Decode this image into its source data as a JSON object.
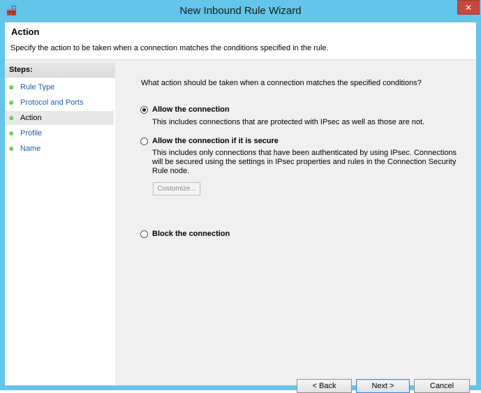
{
  "window": {
    "title": "New Inbound Rule Wizard",
    "close_glyph": "✕"
  },
  "header": {
    "title": "Action",
    "description": "Specify the action to be taken when a connection matches the conditions specified in the rule."
  },
  "steps": {
    "heading": "Steps:",
    "items": [
      {
        "label": "Rule Type"
      },
      {
        "label": "Protocol and Ports"
      },
      {
        "label": "Action"
      },
      {
        "label": "Profile"
      },
      {
        "label": "Name"
      }
    ]
  },
  "main": {
    "question": "What action should be taken when a connection matches the specified conditions?",
    "options": [
      {
        "label": "Allow the connection",
        "description": "This includes connections that are protected with IPsec as well as those are not.",
        "checked": true
      },
      {
        "label": "Allow the connection if it is secure",
        "description_lines": [
          "This includes only connections that have been authenticated by using IPsec.  Connections",
          "will be secured using the settings in IPsec properties and rules in the Connection Security",
          "Rule node."
        ],
        "checked": false
      },
      {
        "label": "Block the connection",
        "checked": false
      }
    ],
    "customize_label": "Customize..."
  },
  "footer": {
    "back_label": "< Back",
    "next_label": "Next >",
    "cancel_label": "Cancel"
  },
  "colors": {
    "frame": "#63c5e9",
    "close": "#c7483f",
    "link": "#1f5fa8"
  },
  "icons": {
    "app": "firewall-wizard-icon",
    "close": "close-icon",
    "step_bullet": "green-dot-icon"
  }
}
